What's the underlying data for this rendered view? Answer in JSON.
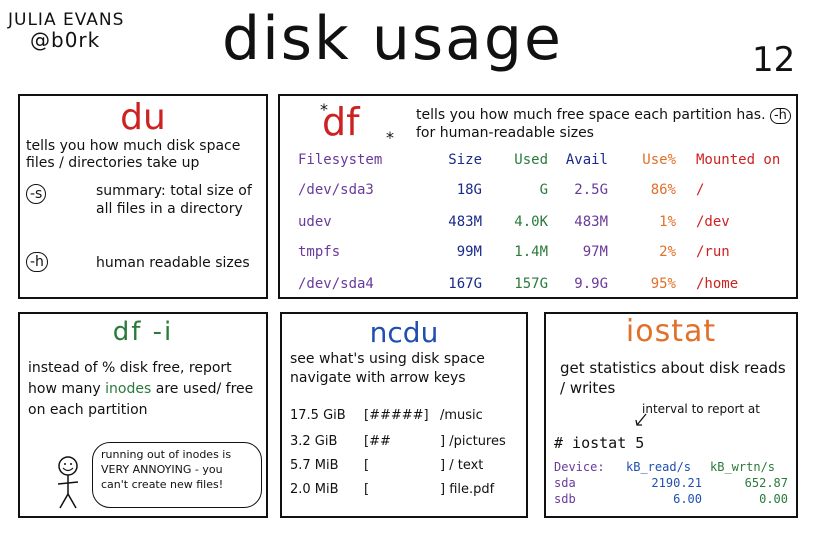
{
  "header": {
    "author_name": "JULIA EVANS",
    "author_handle": "@b0rk",
    "title": "disk usage",
    "page_number": "12"
  },
  "du": {
    "title": "du",
    "description": "tells you how much disk space files / directories take up",
    "flag_s": "-s",
    "flag_s_desc": "summary: total size of all files in a directory",
    "flag_h": "-h",
    "flag_h_desc": "human readable sizes"
  },
  "df": {
    "title": "df",
    "star": "*",
    "description_prefix": "tells you how much free space each partition has.",
    "flag_h": "-h",
    "description_suffix": "for human-readable sizes",
    "headers": [
      "Filesystem",
      "Size",
      "Used",
      "Avail",
      "Use%",
      "Mounted on"
    ],
    "rows": [
      [
        "/dev/sda3",
        "18G",
        "G",
        "2.5G",
        "86%",
        "/"
      ],
      [
        "udev",
        "483M",
        "4.0K",
        "483M",
        "1%",
        "/dev"
      ],
      [
        "tmpfs",
        "99M",
        "1.4M",
        "97M",
        "2%",
        "/run"
      ],
      [
        "/dev/sda4",
        "167G",
        "157G",
        "9.9G",
        "95%",
        "/home"
      ]
    ]
  },
  "dfi": {
    "title": "df -i",
    "desc_before": "instead of % disk free, report how many",
    "desc_highlight": "inodes",
    "desc_after": "are used/ free on each partition",
    "bubble": "running out of inodes is VERY ANNOYING - you can't create new files!"
  },
  "ncdu": {
    "title": "ncdu",
    "description": "see what's using disk space navigate with arrow keys",
    "rows": [
      [
        "17.5 GiB",
        "[#####]",
        "/music"
      ],
      [
        "3.2 GiB",
        "[##",
        "] /pictures"
      ],
      [
        "5.7 MiB",
        "[",
        "] / text"
      ],
      [
        "2.0 MiB",
        "[",
        "] file.pdf"
      ]
    ]
  },
  "iostat": {
    "title": "iostat",
    "description": "get statistics about disk reads / writes",
    "note": "interval to report at",
    "command": "# iostat 5",
    "headers": [
      "Device:",
      "kB_read/s",
      "kB_wrtn/s"
    ],
    "rows": [
      [
        "sda",
        "2190.21",
        "652.87"
      ],
      [
        "sdb",
        "6.00",
        "0.00"
      ]
    ]
  },
  "colors": {
    "red": "#cc2222",
    "purple": "#6a3a9a",
    "navy": "#1a2a8a",
    "green": "#2a7a3a",
    "orange": "#e0702a",
    "blue": "#1f4fb0",
    "ink": "#111111"
  }
}
